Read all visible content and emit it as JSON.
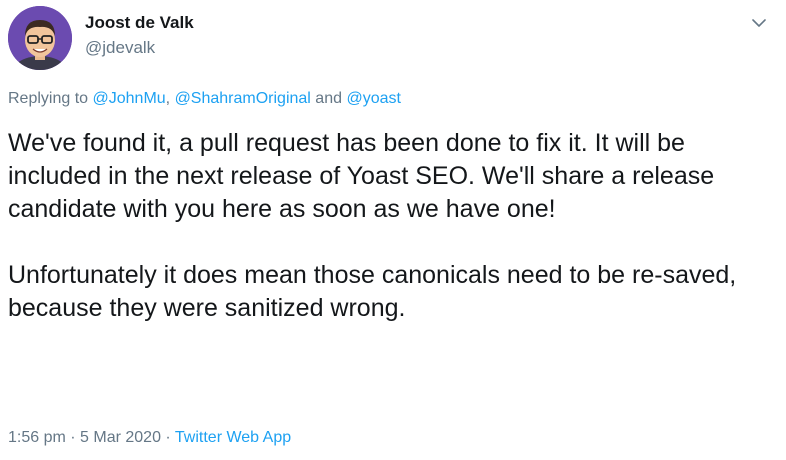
{
  "author": {
    "display_name": "Joost de Valk",
    "handle": "@jdevalk"
  },
  "reply": {
    "prefix": "Replying to ",
    "mention_1": "@JohnMu",
    "separator_1": ", ",
    "mention_2": "@ShahramOriginal",
    "separator_2": " and ",
    "mention_3": "@yoast"
  },
  "tweet": {
    "paragraph_1": "We've found it, a pull request has been done to fix it. It will be included in the next release of Yoast SEO. We'll share a release candidate with you here as soon as we have one!",
    "paragraph_2": "Unfortunately it does mean those canonicals need to be re-saved, because they were sanitized wrong."
  },
  "meta": {
    "time": "1:56 pm",
    "dot_1": " · ",
    "date": "5 Mar 2020",
    "dot_2": " · ",
    "source": "Twitter Web App"
  },
  "icons": {
    "menu": "chevron-down-icon",
    "avatar": "user-avatar"
  },
  "colors": {
    "text": "#14171a",
    "secondary": "#657786",
    "link": "#1da1f2",
    "avatar_bg": "#6b4bb0"
  }
}
